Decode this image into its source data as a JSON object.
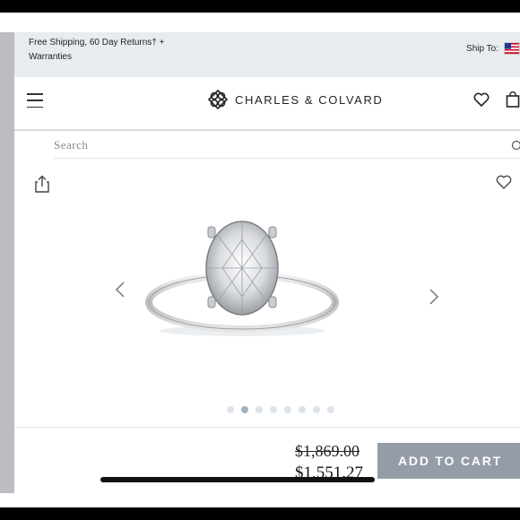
{
  "promo": {
    "shipping_text": "Free Shipping, 60 Day Returns† + Warranties",
    "ship_to_label": "Ship To:",
    "flag_icon": "us-flag-icon"
  },
  "header": {
    "menu_icon": "hamburger-menu-icon",
    "brand": "CHARLES & COLVARD",
    "wishlist_icon": "heart-icon",
    "cart_icon": "shopping-bag-icon"
  },
  "search": {
    "placeholder": "Search",
    "value": "",
    "icon": "search-icon"
  },
  "product": {
    "share_icon": "share-icon",
    "wishlist_icon": "heart-icon",
    "image": "oval-solitaire-engagement-ring",
    "gallery_count": 8,
    "gallery_active_index": 1
  },
  "purchase": {
    "original_price": "$1,869.00",
    "sale_price": "$1,551.27",
    "add_to_cart_label": "ADD TO CART"
  },
  "colors": {
    "promo_bg": "#e9ecef",
    "button_bg": "#949ca7",
    "dot_active": "#9fb0c0",
    "dot_inactive": "#dce3ea"
  }
}
